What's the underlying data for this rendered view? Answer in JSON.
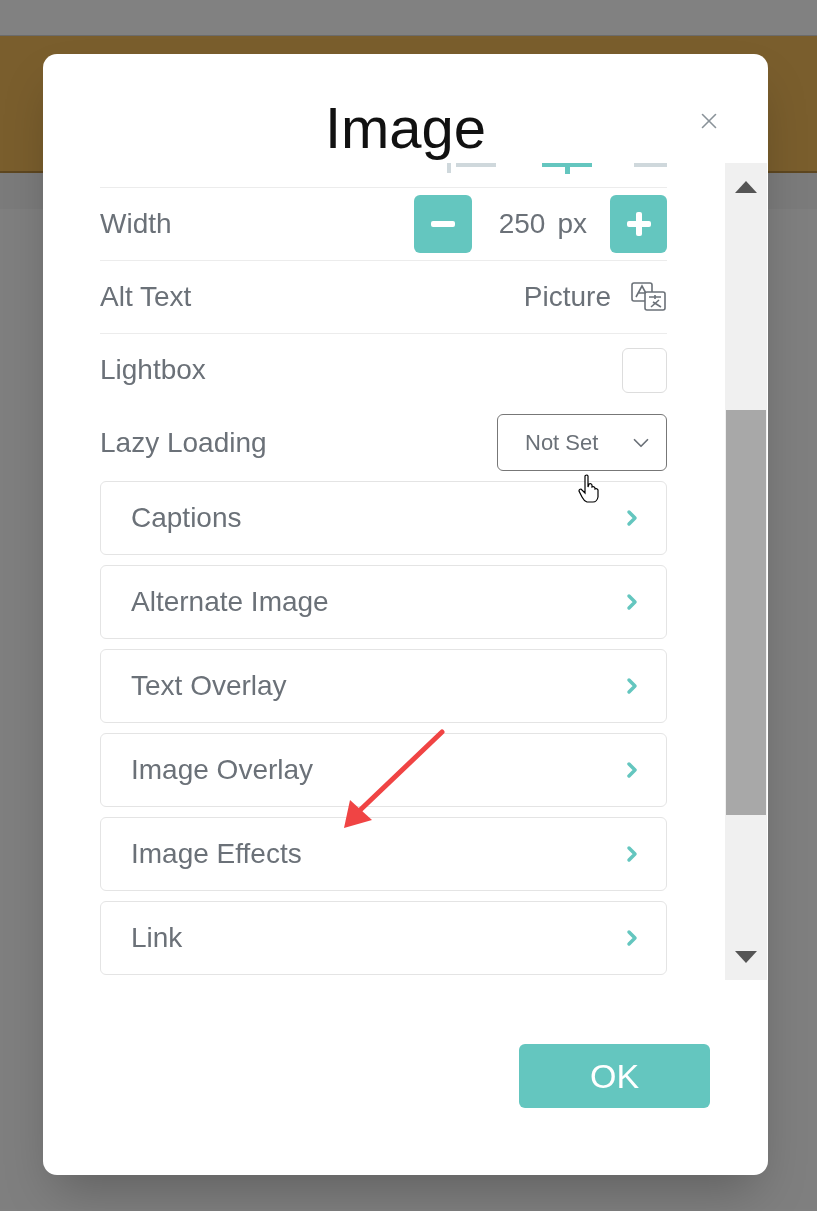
{
  "dialog": {
    "title": "Image"
  },
  "settings": [
    {
      "kind": "stepper",
      "label": "Width",
      "value": "250",
      "unit": "px"
    },
    {
      "kind": "text",
      "label": "Alt Text",
      "value": "Picture"
    },
    {
      "kind": "checkbox",
      "label": "Lightbox",
      "checked": false
    },
    {
      "kind": "select",
      "label": "Lazy Loading",
      "value": "Not Set"
    }
  ],
  "sections": [
    {
      "label": "Captions"
    },
    {
      "label": "Alternate Image"
    },
    {
      "label": "Text Overlay"
    },
    {
      "label": "Image Overlay"
    },
    {
      "label": "Image Effects"
    },
    {
      "label": "Link"
    }
  ],
  "ok_button": "OK"
}
